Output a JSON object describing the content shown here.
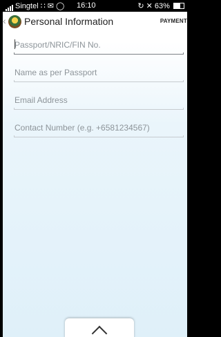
{
  "status_bar": {
    "carrier": "Singtel",
    "time": "16:10",
    "battery": "63%"
  },
  "header": {
    "title": "Personal Information",
    "next_tab": "PAYMENT"
  },
  "form": {
    "passport": {
      "placeholder": "Passport/NRIC/FIN No.",
      "value": ""
    },
    "name": {
      "placeholder": "Name as per Passport",
      "value": ""
    },
    "email": {
      "placeholder": "Email Address",
      "value": ""
    },
    "contact": {
      "placeholder": "Contact Number (e.g. +6581234567)",
      "value": ""
    }
  },
  "icons": {
    "back": "chevron-left-icon",
    "logo": "singapore-crest-logo",
    "expand": "chevron-up-icon"
  }
}
